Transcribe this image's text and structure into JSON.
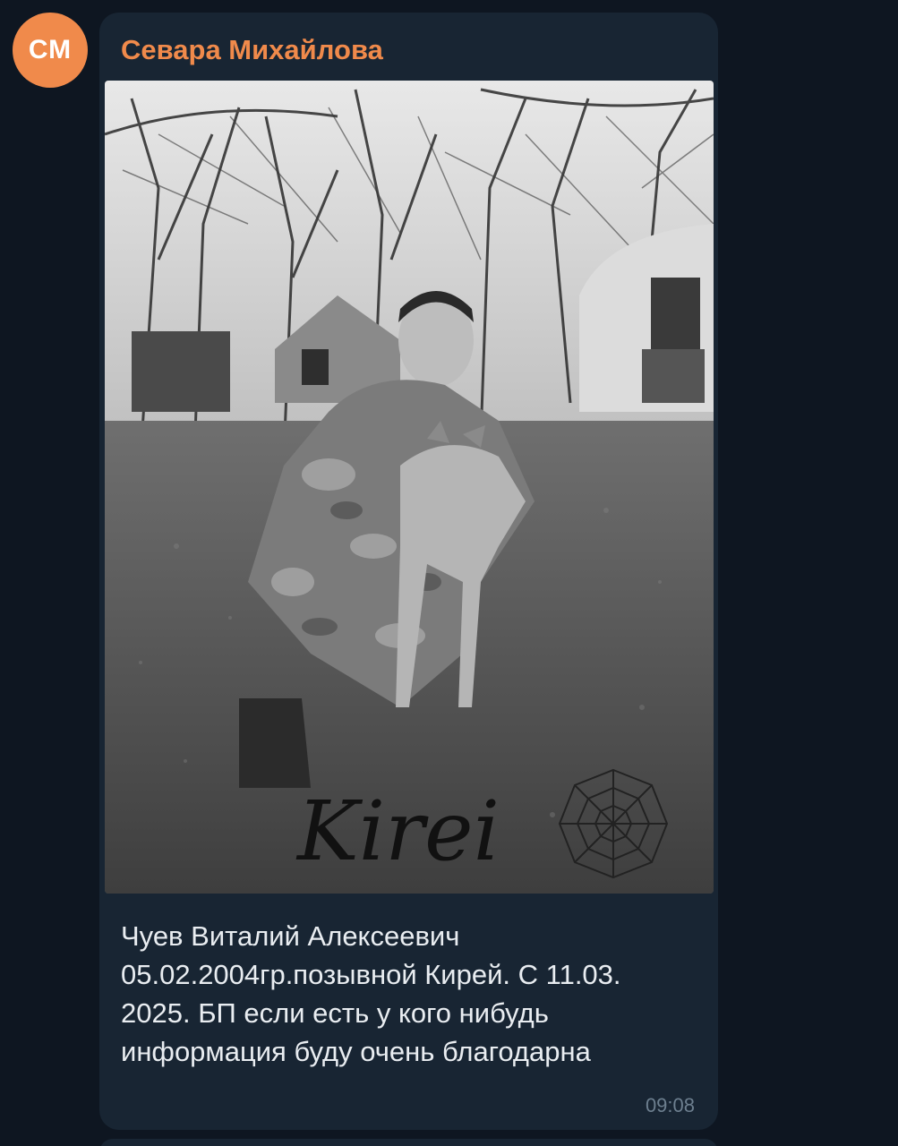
{
  "message": {
    "avatar_initials": "СМ",
    "sender_name": "Севара Михайлова",
    "photo": {
      "description_icon": "photo-icon",
      "signature_text": "Kirei"
    },
    "caption": "Чуев Виталий Алексеевич\n05.02.2004гр.позывной Кирей. С 11.03.\n2025. БП если есть у кого нибудь\nинформация буду очень благодарна",
    "time": "09:08"
  },
  "colors": {
    "background": "#0e1621",
    "bubble": "#182533",
    "accent": "#f08a4b",
    "text": "#e9edf1",
    "time": "#6d7f8f"
  }
}
